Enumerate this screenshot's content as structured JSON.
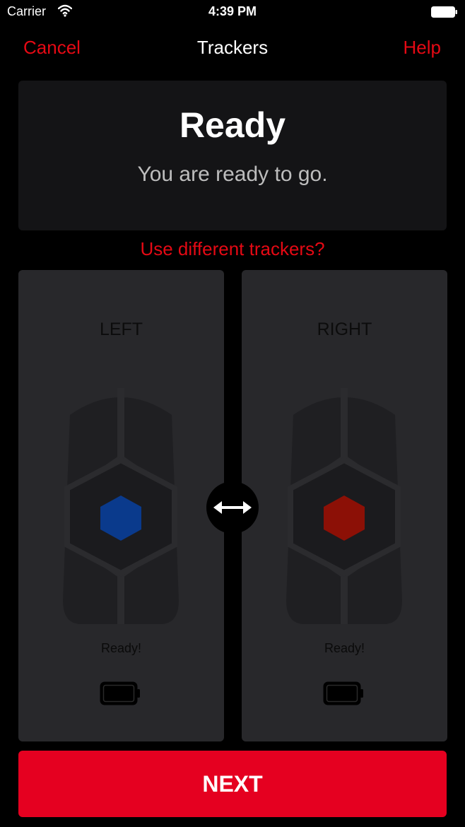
{
  "status_bar": {
    "carrier": "Carrier",
    "time": "4:39 PM",
    "icons": [
      "wifi-icon",
      "battery-icon"
    ]
  },
  "nav": {
    "cancel_label": "Cancel",
    "title": "Trackers",
    "help_label": "Help"
  },
  "ready": {
    "title": "Ready",
    "subtitle": "You are ready to go."
  },
  "change_link": "Use different trackers?",
  "trackers": [
    {
      "label": "LEFT",
      "status": "Ready!",
      "color": "#0a3a8c",
      "icon": "insole-icon"
    },
    {
      "label": "RIGHT",
      "status": "Ready!",
      "color": "#8c1006",
      "icon": "insole-icon"
    }
  ],
  "swap_icon": "swap-arrows-icon",
  "next_label": "NEXT",
  "colors": {
    "accent": "#e50914",
    "primary_button": "#e50020",
    "background": "#000000",
    "panel": "#28282b",
    "card": "#141416"
  }
}
